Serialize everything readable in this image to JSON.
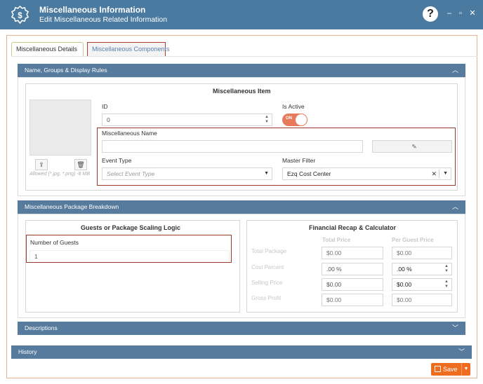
{
  "header": {
    "title": "Miscellaneous Information",
    "subtitle": "Edit Miscellaneous Related Information",
    "help_label": "?",
    "minimize_label": "‒",
    "maximize_label": "▫",
    "close_label": "✕"
  },
  "tabs": [
    {
      "label": "Miscellaneous Details"
    },
    {
      "label": "Miscellaneous Components"
    }
  ],
  "panels": {
    "name_groups": {
      "title": "Name, Groups & Display Rules"
    },
    "package": {
      "title": "Miscellaneous Package Breakdown"
    },
    "descriptions": {
      "title": "Descriptions"
    },
    "history": {
      "title": "History"
    }
  },
  "misc_item": {
    "title": "Miscellaneous Item",
    "image_hint": "Allowed (*.jpg, *.png) -8 MB",
    "id_label": "ID",
    "id_value": "0",
    "is_active_label": "Is Active",
    "toggle_text": "ON",
    "name_label": "Miscellaneous Name",
    "name_value": "",
    "event_type_label": "Event Type",
    "event_type_placeholder": "Select Event Type",
    "master_filter_label": "Master Filter",
    "master_filter_value": "Ezq Cost Center",
    "clear_label": "✕",
    "dropdown_icon": "▼"
  },
  "guests": {
    "title": "Guests or Package Scaling Logic",
    "label": "Number of Guests",
    "value": "1"
  },
  "financial": {
    "title": "Financial Recap & Calculator",
    "col_total": "Total Price",
    "col_per_guest": "Per Guest Price",
    "rows": [
      {
        "label": "Total Package",
        "total": "$0.00",
        "per_guest": "$0.00"
      },
      {
        "label": "Cost Percent",
        "total": ".00 %",
        "per_guest": ".00 %"
      },
      {
        "label": "Selling Price",
        "total": "$0.00",
        "per_guest": "$0.00"
      },
      {
        "label": "Gross Profit",
        "total": "$0.00",
        "per_guest": "$0.00"
      }
    ]
  },
  "footer": {
    "save_label": "Save",
    "save_caret": "▼"
  },
  "colors": {
    "header_bg": "#4a7aa0",
    "panel_header": "#577b9c",
    "accent": "#ef6c1f",
    "highlight": "#9a3a2a",
    "toggle_on": "#e67a5a"
  }
}
